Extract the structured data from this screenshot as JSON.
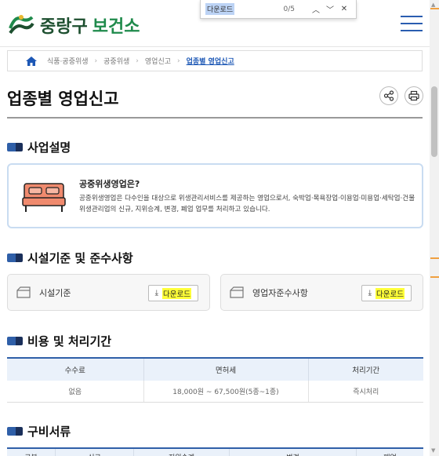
{
  "findbar": {
    "query": "다운로드",
    "count": "0/5",
    "prev_icon": "chevron-up-icon",
    "next_icon": "chevron-down-icon",
    "close_icon": "close-icon"
  },
  "header": {
    "logo_text_1": "중랑구",
    "logo_text_2": "보건소",
    "menu_icon": "hamburger-icon"
  },
  "breadcrumb": {
    "items": [
      "식품·공중위생",
      "공중위생",
      "영업신고",
      "업종별 영업신고"
    ]
  },
  "page": {
    "title": "업종별 영업신고"
  },
  "sections": {
    "business": "사업설명",
    "facility": "시설기준 및 준수사항",
    "cost": "비용 및 처리기간",
    "docs": "구비서류"
  },
  "info": {
    "title": "공중위생영업은?",
    "desc": "공중위생영업은 다수인을 대상으로 위생관리서비스를 제공하는 영업으로서, 숙박업·목욕장업·이용업·미용업·세탁업·건물위생관리업의 신규, 지위승계, 변경, 폐업 업무를 처리하고 있습니다."
  },
  "downloads": [
    {
      "name": "시설기준",
      "button": "다운로드"
    },
    {
      "name": "영업자준수사항",
      "button": "다운로드"
    }
  ],
  "fee_table": {
    "headers": [
      "수수료",
      "면허세",
      "처리기간"
    ],
    "rows": [
      [
        "없음",
        "18,000원 ~ 67,500원(5종~1종)",
        "즉시처리"
      ]
    ]
  },
  "doc_table": {
    "headers": [
      "구분",
      "신규",
      "지위승계",
      "변경",
      "폐업"
    ]
  },
  "colors": {
    "accent": "#2f5fa8",
    "highlight": "#ffff38",
    "logo_green": "#1f8a4b"
  }
}
